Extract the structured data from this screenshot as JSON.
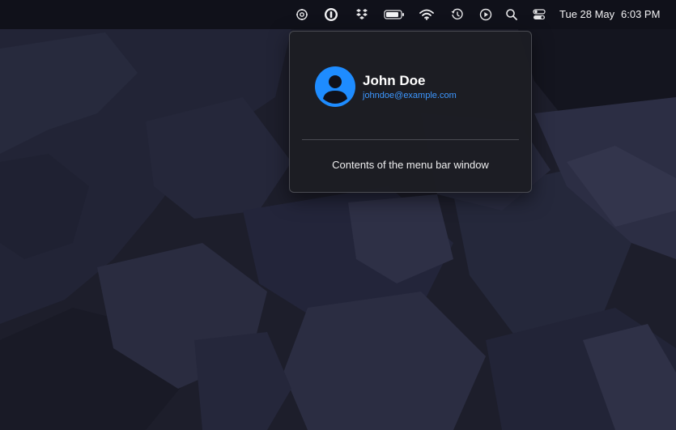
{
  "menubar": {
    "icons": [
      "status-gear-icon",
      "password-manager-icon",
      "dropbox-icon",
      "battery-icon",
      "wifi-icon",
      "time-machine-icon",
      "play-icon",
      "spotlight-search-icon",
      "control-center-icon"
    ],
    "date": "Tue 28 May",
    "time": "6:03 PM"
  },
  "popover": {
    "user_name": "John Doe",
    "user_email": "johndoe@example.com",
    "contents_text": "Contents of the menu bar window"
  },
  "colors": {
    "menubar_bg": "#10111a",
    "desktop_bg": "#1b1c29",
    "avatar_bg": "#1e8cff",
    "email_accent": "#3d97ff",
    "popover_bg": "#1c1d23"
  }
}
